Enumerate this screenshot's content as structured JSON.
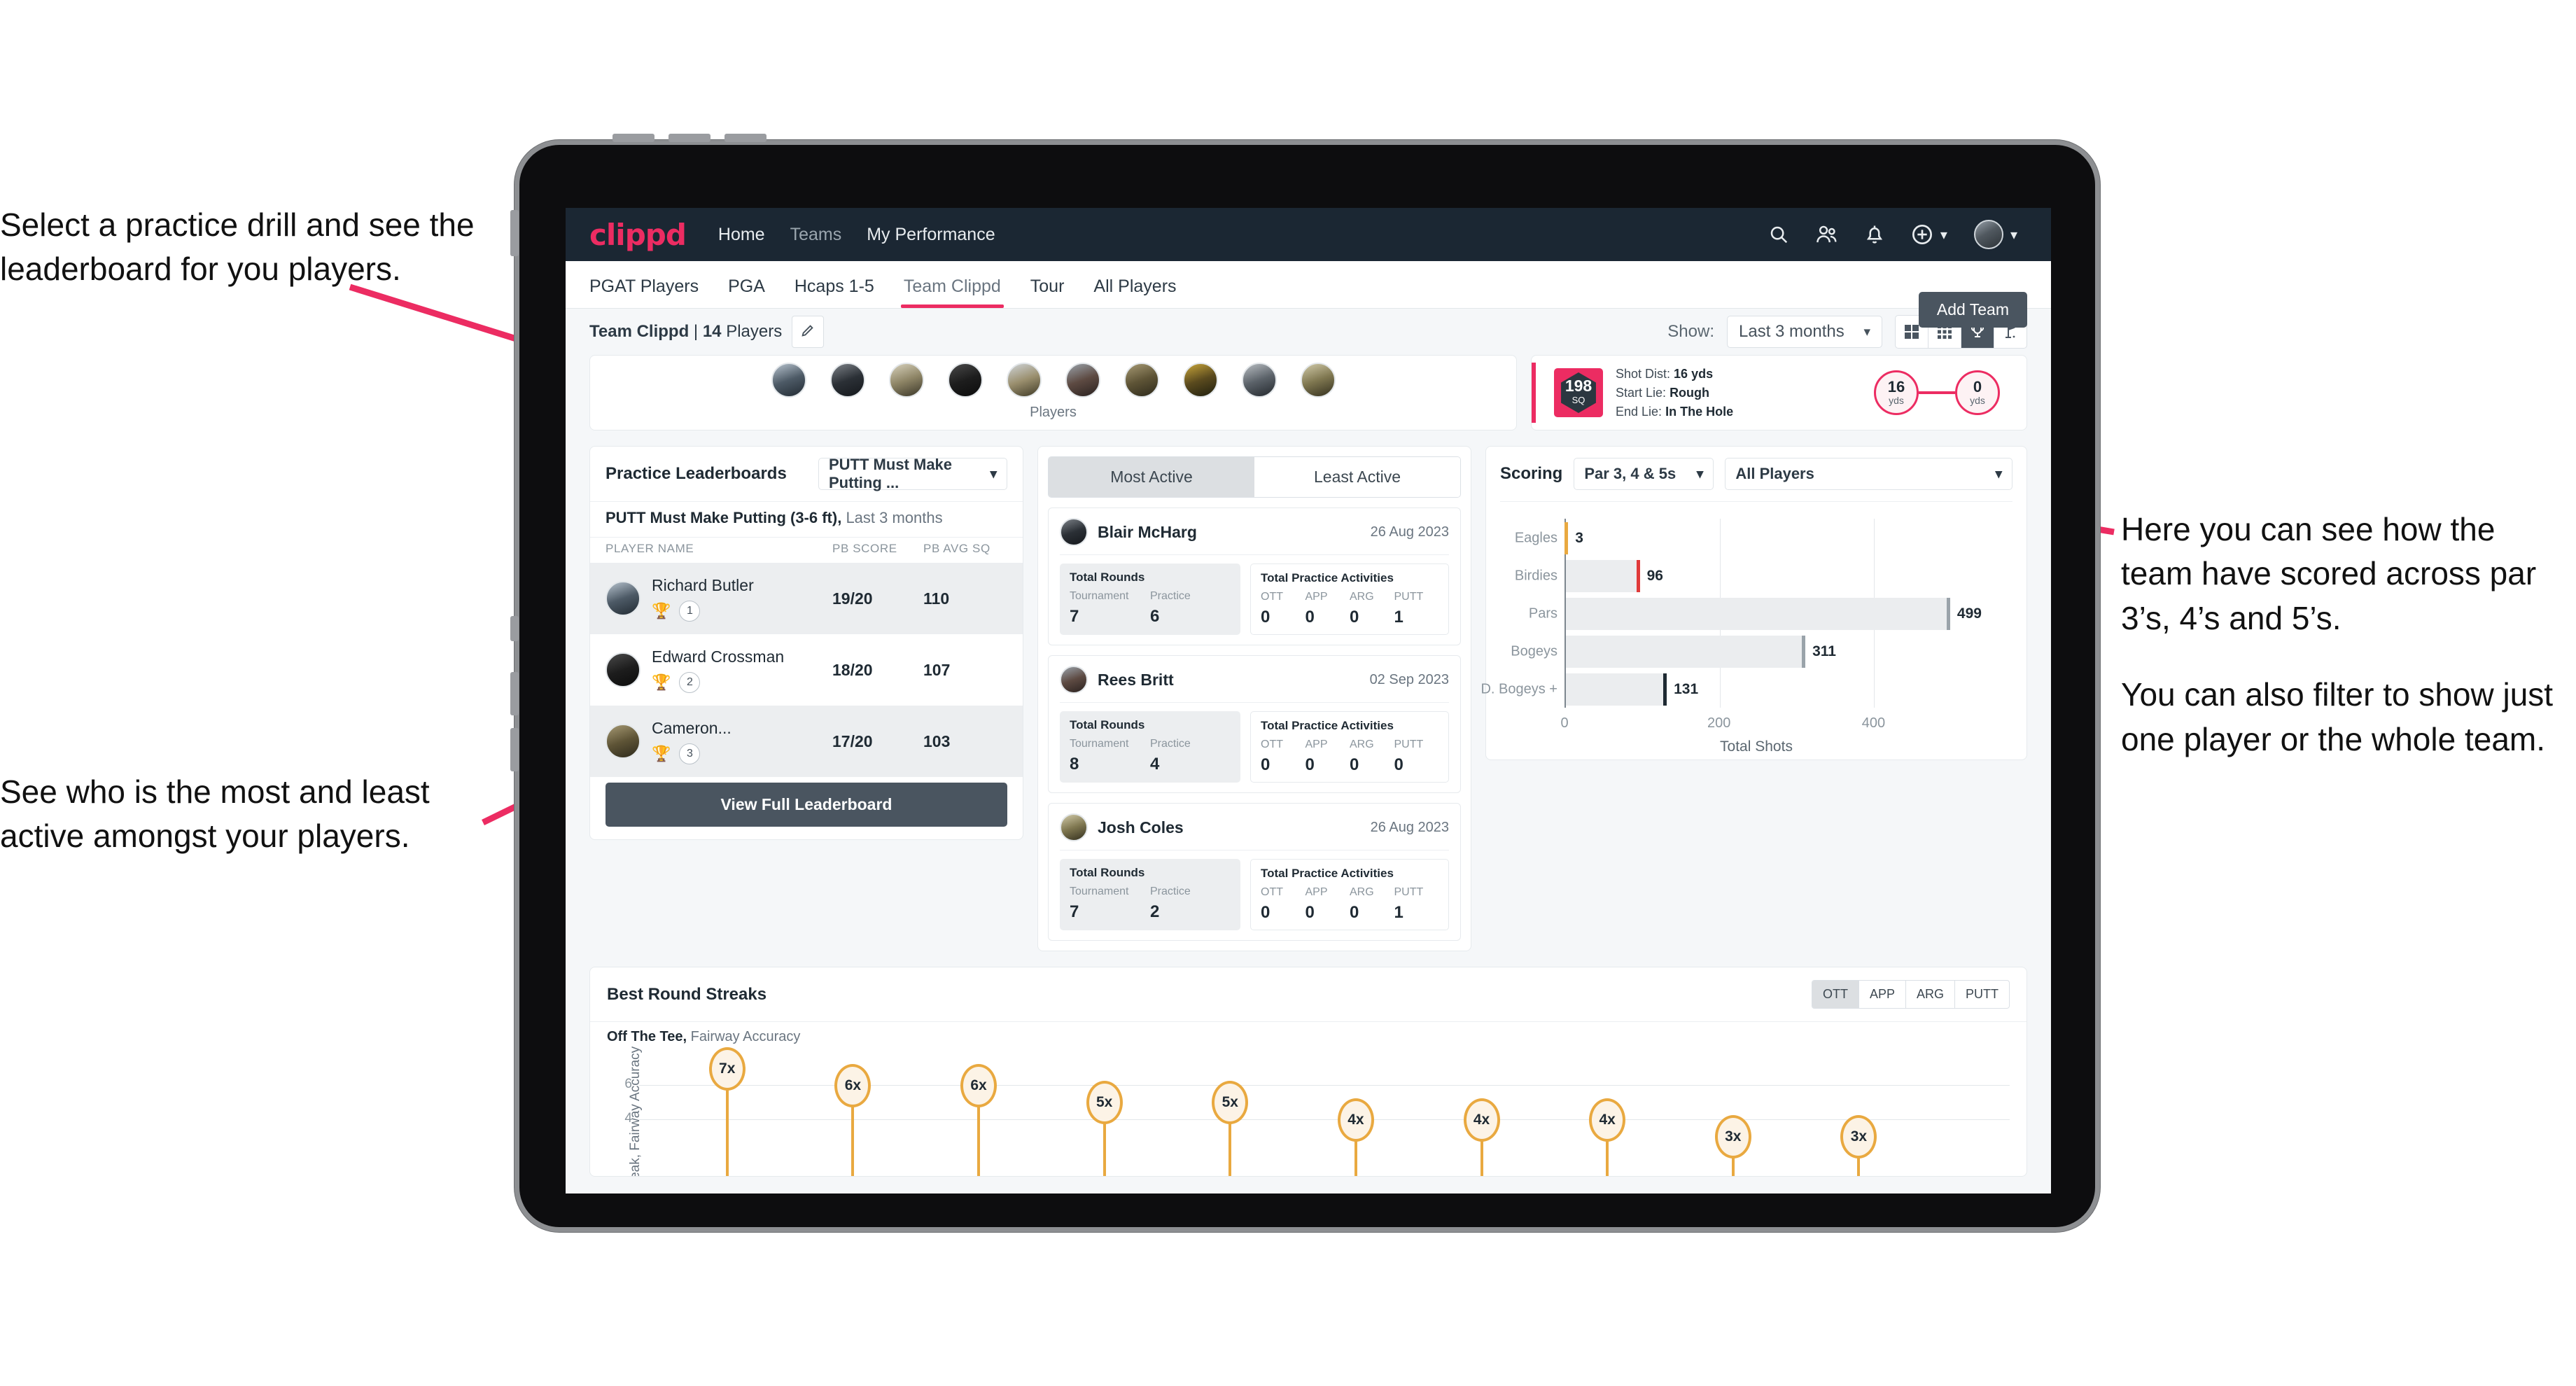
{
  "annotations": {
    "top_left": "Select a practice drill and see the leaderboard for you players.",
    "bottom_left": "See who is the most and least active amongst your players.",
    "right_1": "Here you can see how the team have scored across par 3’s, 4’s and 5’s.",
    "right_2": "You can also filter to show just one player or the whole team."
  },
  "navbar": {
    "brand": "clippd",
    "links": [
      {
        "label": "Home",
        "dim": false
      },
      {
        "label": "Teams",
        "dim": true
      },
      {
        "label": "My Performance",
        "dim": false
      }
    ],
    "icons": [
      "search-icon",
      "people-icon",
      "bell-icon",
      "plus-circle-icon",
      "avatar"
    ]
  },
  "tabs": {
    "items": [
      "PGAT Players",
      "PGA",
      "Hcaps 1-5",
      "Team Clippd",
      "Tour",
      "All Players"
    ],
    "active_index": 3,
    "add_team_label": "Add Team"
  },
  "toolbar": {
    "team_name": "Team Clippd",
    "team_separator": " | ",
    "player_count": "14",
    "players_word": "Players",
    "show_label": "Show:",
    "range_value": "Last 3 months",
    "view_buttons": [
      "grid-large-icon",
      "grid-small-icon",
      "trophy-icon",
      "flag-icon"
    ],
    "view_active_index": 2
  },
  "players_strip": {
    "label": "Players",
    "avatar_count": 10
  },
  "shot_card": {
    "sq_value": "198",
    "sq_unit": "SQ",
    "lines": [
      {
        "label": "Shot Dist:",
        "value": "16 yds"
      },
      {
        "label": "Start Lie:",
        "value": "Rough"
      },
      {
        "label": "End Lie:",
        "value": "In The Hole"
      }
    ],
    "start_dist": "16",
    "start_unit": "yds",
    "end_dist": "0",
    "end_unit": "yds"
  },
  "practice_leaderboard": {
    "title": "Practice Leaderboards",
    "drill_select": "PUTT Must Make Putting ...",
    "subtitle_bold": "PUTT Must Make Putting (3-6 ft),",
    "subtitle_rest": " Last 3 months",
    "columns": [
      "PLAYER NAME",
      "PB SCORE",
      "PB AVG SQ"
    ],
    "rows": [
      {
        "name": "Richard Butler",
        "rank": "1",
        "trophy": "gold",
        "pb_score": "19/20",
        "pb_avg_sq": "110"
      },
      {
        "name": "Edward Crossman",
        "rank": "2",
        "trophy": "silver",
        "pb_score": "18/20",
        "pb_avg_sq": "107"
      },
      {
        "name": "Cameron...",
        "rank": "3",
        "trophy": "bronze",
        "pb_score": "17/20",
        "pb_avg_sq": "103"
      }
    ],
    "button_label": "View Full Leaderboard"
  },
  "activity": {
    "tabs": [
      "Most Active",
      "Least Active"
    ],
    "active_index": 0,
    "rounds_title": "Total Rounds",
    "rounds_cols": [
      "Tournament",
      "Practice"
    ],
    "acts_title": "Total Practice Activities",
    "acts_cols": [
      "OTT",
      "APP",
      "ARG",
      "PUTT"
    ],
    "cards": [
      {
        "name": "Blair McHarg",
        "date": "26 Aug 2023",
        "tournament": "7",
        "practice": "6",
        "ott": "0",
        "app": "0",
        "arg": "0",
        "putt": "1"
      },
      {
        "name": "Rees Britt",
        "date": "02 Sep 2023",
        "tournament": "8",
        "practice": "4",
        "ott": "0",
        "app": "0",
        "arg": "0",
        "putt": "0"
      },
      {
        "name": "Josh Coles",
        "date": "26 Aug 2023",
        "tournament": "7",
        "practice": "2",
        "ott": "0",
        "app": "0",
        "arg": "0",
        "putt": "1"
      }
    ]
  },
  "scoring": {
    "title": "Scoring",
    "par_select": "Par 3, 4 & 5s",
    "player_select": "All Players"
  },
  "streaks": {
    "title": "Best Round Streaks",
    "buttons": [
      "OTT",
      "APP",
      "ARG",
      "PUTT"
    ],
    "active_index": 0,
    "subtitle_bold": "Off The Tee,",
    "subtitle_rest": " Fairway Accuracy"
  },
  "colors": {
    "brand_pink": "#ec2c62",
    "nav_dark": "#1b2733",
    "button_slate": "#4a5560",
    "streak_amber": "#e9a940",
    "eagle_amber": "#e9a940",
    "birdie_red": "#e03a3a",
    "bogey_grey": "#9aa3aa",
    "dbogey_dark": "#1f2a33"
  },
  "chart_data": [
    {
      "type": "bar",
      "orientation": "horizontal",
      "title": "Scoring",
      "categories": [
        "Eagles",
        "Birdies",
        "Pars",
        "Bogeys",
        "D. Bogeys +"
      ],
      "values": [
        3,
        96,
        499,
        311,
        131
      ],
      "bar_tip_colors": [
        "#e9a940",
        "#e03a3a",
        "#9aa3aa",
        "#9aa3aa",
        "#1f2a33"
      ],
      "xlabel": "Total Shots",
      "ylabel": "",
      "xlim": [
        0,
        540
      ],
      "xticks": [
        0,
        200,
        400
      ],
      "xtick_labels": [
        "0",
        "200",
        "400"
      ],
      "grid": true,
      "legend": false
    },
    {
      "type": "bar",
      "title": "Best Round Streaks",
      "subtitle": "Off The Tee, Fairway Accuracy",
      "ylabel": "Streak, Fairway Accuracy",
      "xlabel": "",
      "values": [
        7,
        6,
        6,
        5,
        5,
        4,
        4,
        4,
        3,
        3
      ],
      "value_labels": [
        "7x",
        "6x",
        "6x",
        "5x",
        "5x",
        "4x",
        "4x",
        "4x",
        "3x",
        "3x"
      ],
      "ylim": [
        0,
        7.8
      ],
      "yticks": [
        4,
        6
      ],
      "ytick_labels": [
        "4",
        "6"
      ],
      "grid": true,
      "legend": false,
      "marker": "lollipop"
    }
  ]
}
